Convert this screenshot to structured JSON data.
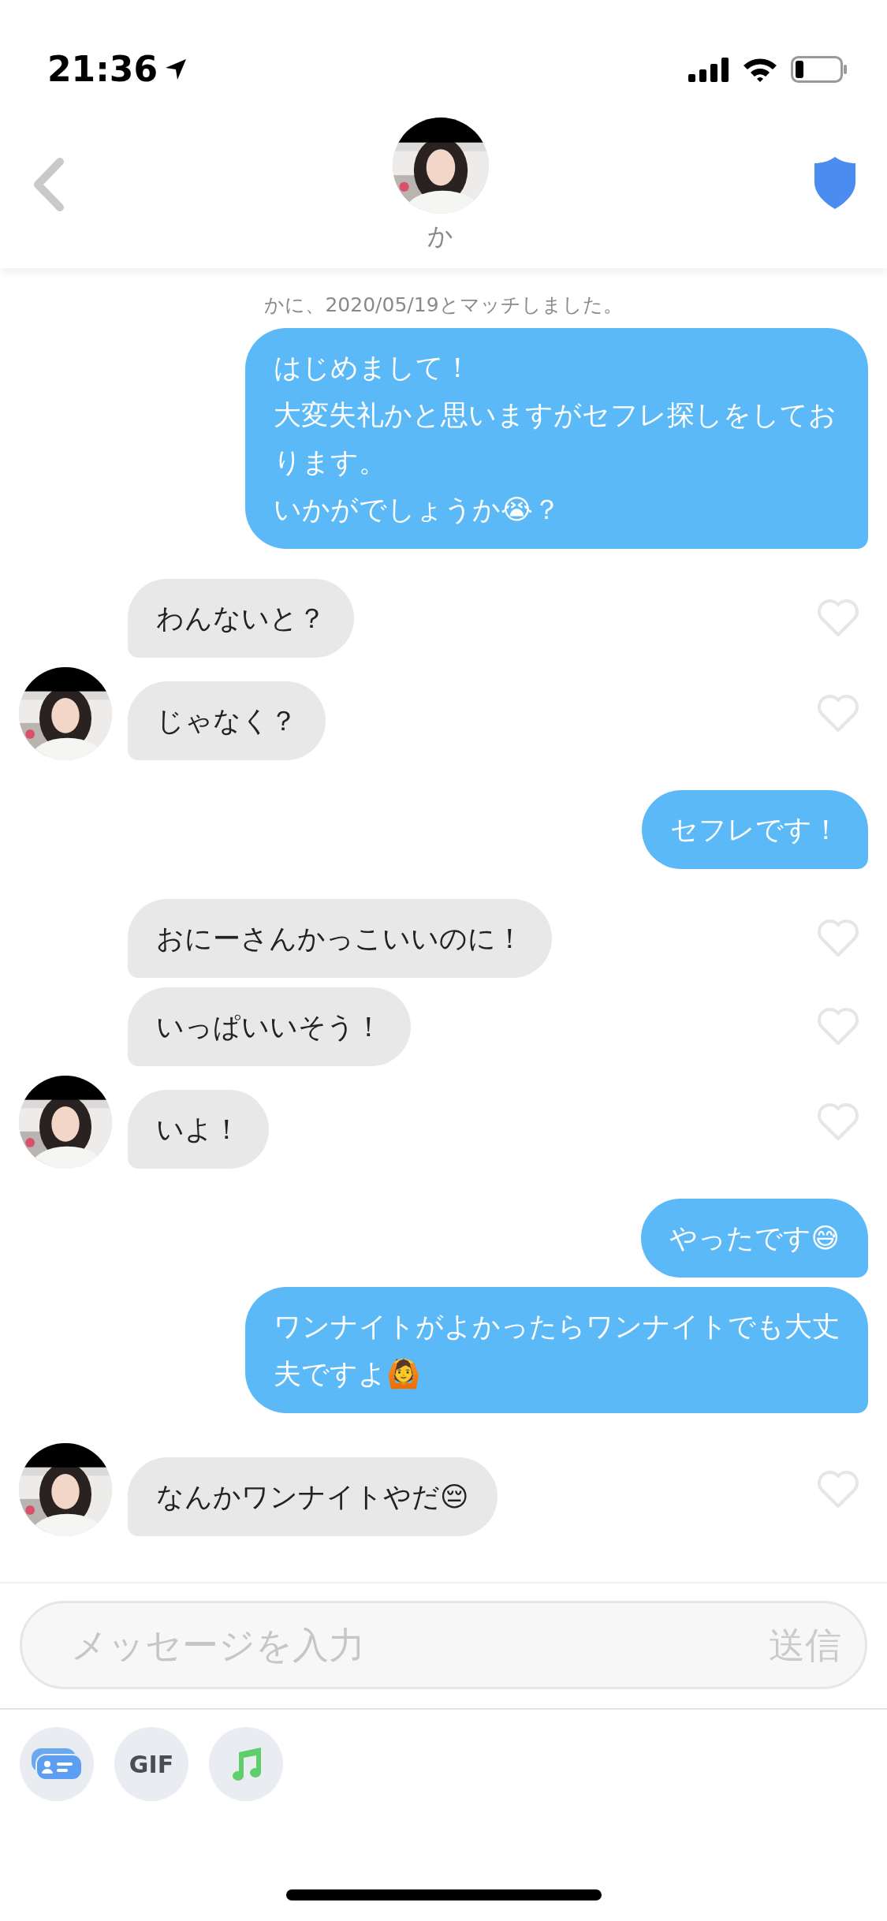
{
  "status_bar": {
    "time": "21:36"
  },
  "header": {
    "name": "か"
  },
  "match_notice": "かに、2020/05/19とマッチしました。",
  "messages": [
    {
      "kind": "outgoing",
      "lines": [
        "はじめまして！",
        "大変失礼かと思いますがセフレ探しをしております。",
        "いかがでしょうか😭？"
      ]
    },
    {
      "kind": "incoming",
      "text": "わんないと？",
      "avatar": false,
      "liked": false
    },
    {
      "kind": "incoming",
      "text": "じゃなく？",
      "avatar": true,
      "liked": false
    },
    {
      "kind": "outgoing",
      "text": "セフレです！"
    },
    {
      "kind": "incoming",
      "text": "おにーさんかっこいいのに！",
      "avatar": false,
      "liked": false
    },
    {
      "kind": "incoming",
      "text": "いっぱいいそう！",
      "avatar": false,
      "liked": false
    },
    {
      "kind": "incoming",
      "text": "いよ！",
      "avatar": true,
      "liked": false
    },
    {
      "kind": "outgoing",
      "text": "やったです😅"
    },
    {
      "kind": "outgoing",
      "text": "ワンナイトがよかったらワンナイトでも大丈夫ですよ🙆"
    },
    {
      "kind": "incoming",
      "text": "なんかワンナイトやだ😔",
      "avatar": true,
      "liked": false
    }
  ],
  "composer": {
    "placeholder": "メッセージを入力",
    "send": "送信"
  },
  "attachments": [
    {
      "kind": "card"
    },
    {
      "kind": "gif",
      "label": "GIF"
    },
    {
      "kind": "music"
    }
  ]
}
